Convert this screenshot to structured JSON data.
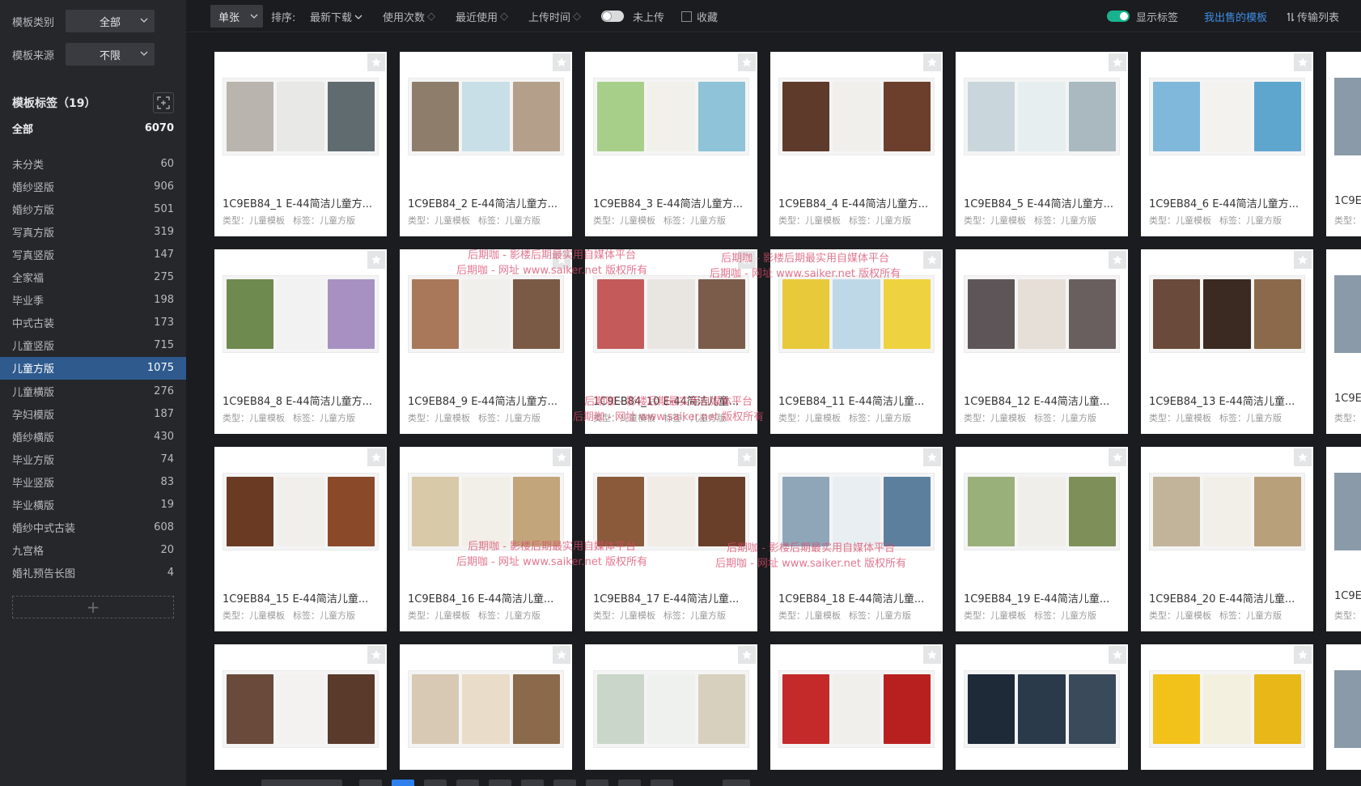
{
  "sidebar": {
    "filters": [
      {
        "label": "模板类别",
        "value": "全部"
      },
      {
        "label": "模板来源",
        "value": "不限"
      }
    ],
    "tags_title": "模板标签（19）",
    "tags": [
      {
        "label": "全部",
        "count": "6070"
      },
      {
        "label": "未分类",
        "count": "60"
      },
      {
        "label": "婚纱竖版",
        "count": "906"
      },
      {
        "label": "婚纱方版",
        "count": "501"
      },
      {
        "label": "写真方版",
        "count": "319"
      },
      {
        "label": "写真竖版",
        "count": "147"
      },
      {
        "label": "全家福",
        "count": "275"
      },
      {
        "label": "毕业季",
        "count": "198"
      },
      {
        "label": "中式古装",
        "count": "173"
      },
      {
        "label": "儿童竖版",
        "count": "715"
      },
      {
        "label": "儿童方版",
        "count": "1075"
      },
      {
        "label": "儿童横版",
        "count": "276"
      },
      {
        "label": "孕妇模版",
        "count": "187"
      },
      {
        "label": "婚纱横版",
        "count": "430"
      },
      {
        "label": "毕业方版",
        "count": "74"
      },
      {
        "label": "毕业竖版",
        "count": "83"
      },
      {
        "label": "毕业横版",
        "count": "19"
      },
      {
        "label": "婚纱中式古装",
        "count": "608"
      },
      {
        "label": "九宫格",
        "count": "20"
      },
      {
        "label": "婚礼预告长图",
        "count": "4"
      }
    ],
    "active_tag": "儿童方版"
  },
  "toolbar": {
    "mode": "单张",
    "sort_label": "排序:",
    "sort_options": [
      "最新下载",
      "使用次数",
      "最近使用",
      "上传时间"
    ],
    "not_uploaded": "未上传",
    "favorites": "收藏",
    "show_tags": "显示标签",
    "my_sold": "我出售的模板",
    "transfer_list": "传输列表",
    "accent": "#3d8ee6",
    "toggle_on_color": "#19b28e"
  },
  "cards": [
    {
      "name": "1C9EB84_1  E-44简洁儿童方...",
      "type": "类型：儿童模板",
      "tag": "标签：儿童方版",
      "colors": [
        "#b9b4ad",
        "#e8e8e6",
        "#5f6b6f"
      ]
    },
    {
      "name": "1C9EB84_2  E-44简洁儿童方...",
      "type": "类型：儿童模板",
      "tag": "标签：儿童方版",
      "colors": [
        "#8f7d6b",
        "#c8dfe8",
        "#b4a08a"
      ]
    },
    {
      "name": "1C9EB84_3  E-44简洁儿童方...",
      "type": "类型：儿童模板",
      "tag": "标签：儿童方版",
      "colors": [
        "#a8cf8a",
        "#f2f0ea",
        "#8fc3d8"
      ]
    },
    {
      "name": "1C9EB84_4  E-44简洁儿童方...",
      "type": "类型：儿童模板",
      "tag": "标签：儿童方版",
      "colors": [
        "#5e3a2a",
        "#f1efec",
        "#6b3f2c"
      ]
    },
    {
      "name": "1C9EB84_5  E-44简洁儿童方...",
      "type": "类型：儿童模板",
      "tag": "标签：儿童方版",
      "colors": [
        "#c9d6dc",
        "#e7eef0",
        "#a9b9bf"
      ]
    },
    {
      "name": "1C9EB84_6  E-44简洁儿童方...",
      "type": "类型：儿童模板",
      "tag": "标签：儿童方版",
      "colors": [
        "#7fb8da",
        "#f4f2ee",
        "#5fa6cf"
      ]
    },
    {
      "name": "1C9EB84_8  E-44简洁儿童方...",
      "type": "类型：儿童模板",
      "tag": "标签：儿童方版",
      "colors": [
        "#6f8a4f",
        "#f2f2f2",
        "#a791c2"
      ]
    },
    {
      "name": "1C9EB84_9  E-44简洁儿童方...",
      "type": "类型：儿童模板",
      "tag": "标签：儿童方版",
      "colors": [
        "#a9785a",
        "#f1efec",
        "#7a5a44"
      ]
    },
    {
      "name": "1C9EB84_10  E-44简洁儿童...",
      "type": "类型：儿童模板",
      "tag": "标签：儿童方版",
      "colors": [
        "#c45a5a",
        "#e9e6e2",
        "#7b5b4a"
      ]
    },
    {
      "name": "1C9EB84_11  E-44简洁儿童...",
      "type": "类型：儿童模板",
      "tag": "标签：儿童方版",
      "colors": [
        "#e8c93a",
        "#bfd8e8",
        "#efd23f"
      ]
    },
    {
      "name": "1C9EB84_12  E-44简洁儿童...",
      "type": "类型：儿童模板",
      "tag": "标签：儿童方版",
      "colors": [
        "#5e5558",
        "#e6dfd8",
        "#6a5f5f"
      ]
    },
    {
      "name": "1C9EB84_13  E-44简洁儿童...",
      "type": "类型：儿童模板",
      "tag": "标签：儿童方版",
      "colors": [
        "#6a4a3a",
        "#3a2a22",
        "#8a6a4a"
      ]
    },
    {
      "name": "1C9EB84_15  E-44简洁儿童...",
      "type": "类型：儿童模板",
      "tag": "标签：儿童方版",
      "colors": [
        "#6b3a22",
        "#f1efec",
        "#8a4a2a"
      ]
    },
    {
      "name": "1C9EB84_16  E-44简洁儿童...",
      "type": "类型：儿童模板",
      "tag": "标签：儿童方版",
      "colors": [
        "#d8c9a8",
        "#f2efe8",
        "#c2a57a"
      ]
    },
    {
      "name": "1C9EB84_17  E-44简洁儿童...",
      "type": "类型：儿童模板",
      "tag": "标签：儿童方版",
      "colors": [
        "#8a5a3a",
        "#f1ece6",
        "#6a3f2a"
      ]
    },
    {
      "name": "1C9EB84_18  E-44简洁儿童...",
      "type": "类型：儿童模板",
      "tag": "标签：儿童方版",
      "colors": [
        "#8fa6b8",
        "#e9eef2",
        "#5c7f9e"
      ]
    },
    {
      "name": "1C9EB84_19  E-44简洁儿童...",
      "type": "类型：儿童模板",
      "tag": "标签：儿童方版",
      "colors": [
        "#9ab07a",
        "#efeeea",
        "#7f8f5a"
      ]
    },
    {
      "name": "1C9EB84_20  E-44简洁儿童...",
      "type": "类型：儿童模板",
      "tag": "标签：儿童方版",
      "colors": [
        "#c2b49a",
        "#f2efe8",
        "#b8a07a"
      ]
    },
    {
      "name": "",
      "type": "",
      "tag": "",
      "colors": [
        "#6a4a3a",
        "#f3f2f0",
        "#5a3a2a"
      ]
    },
    {
      "name": "",
      "type": "",
      "tag": "",
      "colors": [
        "#d8c9b4",
        "#e9ddc9",
        "#8a6a4a"
      ]
    },
    {
      "name": "",
      "type": "",
      "tag": "",
      "colors": [
        "#c9d6c9",
        "#eef1ee",
        "#d8d0bf"
      ]
    },
    {
      "name": "",
      "type": "",
      "tag": "",
      "colors": [
        "#c42a2a",
        "#f1efec",
        "#b82020"
      ]
    },
    {
      "name": "",
      "type": "",
      "tag": "",
      "colors": [
        "#1e2a38",
        "#2a3a4a",
        "#3a4a5a"
      ]
    },
    {
      "name": "",
      "type": "",
      "tag": "",
      "colors": [
        "#f2c21a",
        "#f4f0e0",
        "#e8b818"
      ]
    }
  ],
  "partial_cards": [
    {
      "name": "1C9E",
      "type": "类型："
    },
    {
      "name": "1C9E",
      "type": "类型："
    },
    {
      "name": "1C9E",
      "type": "类型："
    }
  ],
  "watermarks": [
    {
      "line1": "后期咖 - 影楼后期最实用自媒体平台",
      "line2": "后期咖 - 网址 www.saiker.net 版权所有"
    },
    {
      "line1": "后期咖 - 影楼后期最实用自媒体平台",
      "line2": "后期咖 - 网址 www.saiker.net 版权所有"
    },
    {
      "line1": "后期咖 - 影楼后期最实用自媒体平台",
      "line2": "后期咖 - 网址 www.saiker.net 版权所有"
    },
    {
      "line1": "后期咖 - 影楼后期最实用自媒体平台",
      "line2": "后期咖 - 网址 www.saiker.net 版权所有"
    },
    {
      "line1": "后期咖 - 影楼后期最实用自媒体平台",
      "line2": "后期咖 - 网址 www.saiker.net 版权所有"
    }
  ]
}
